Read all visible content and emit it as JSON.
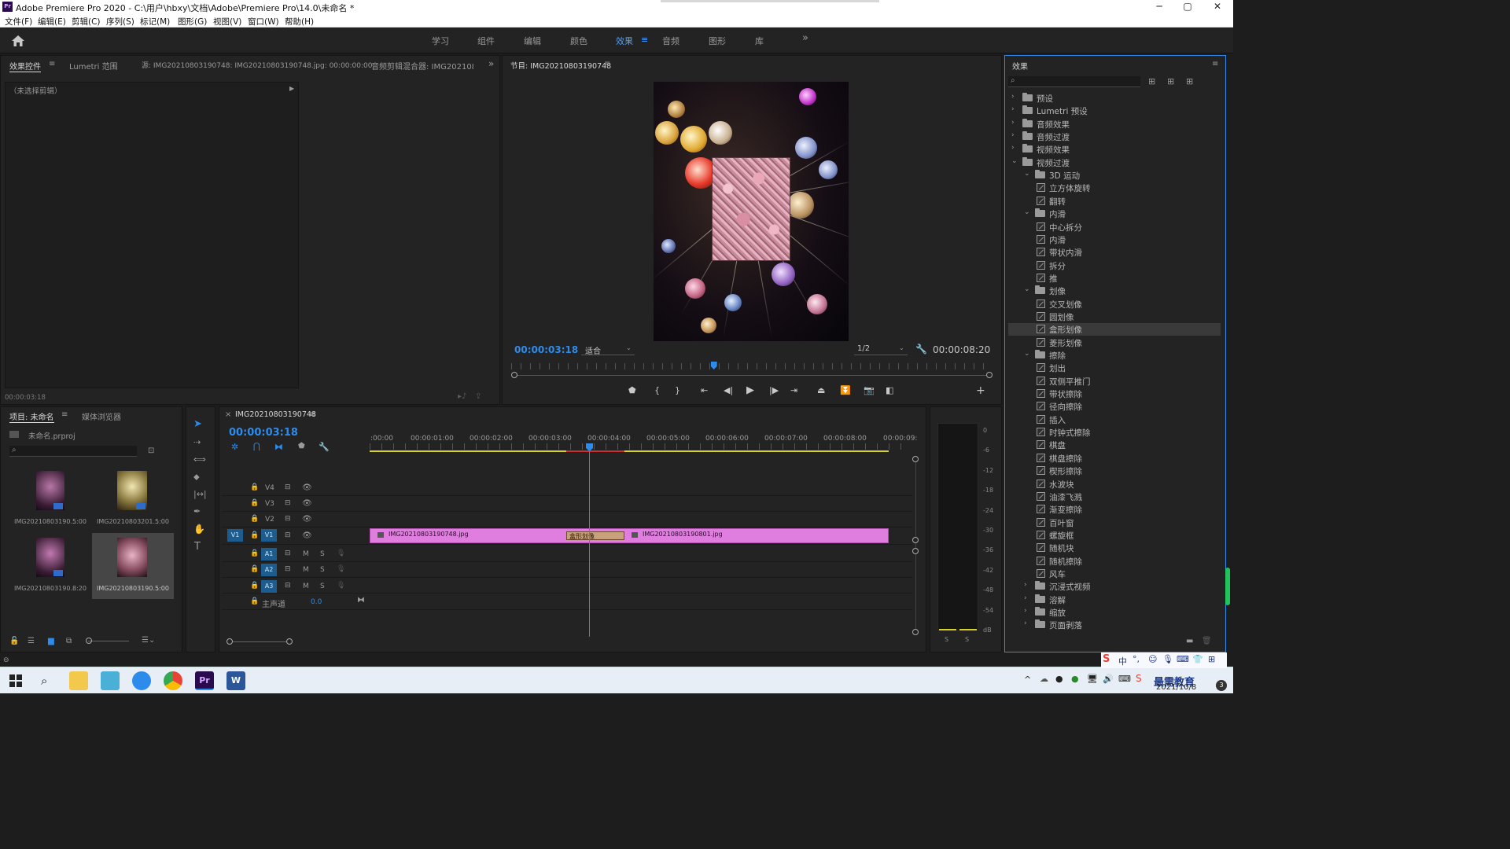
{
  "window": {
    "title": "Adobe Premiere Pro 2020 - C:\\用户\\hbxy\\文档\\Adobe\\Premiere Pro\\14.0\\未命名 *",
    "minimize": "─",
    "maximize": "▢",
    "close": "✕"
  },
  "menu": [
    "文件(F)",
    "编辑(E)",
    "剪辑(C)",
    "序列(S)",
    "标记(M)",
    "图形(G)",
    "视图(V)",
    "窗口(W)",
    "帮助(H)"
  ],
  "workspaces": {
    "items": [
      "学习",
      "组件",
      "编辑",
      "颜色",
      "效果",
      "音频",
      "图形",
      "库"
    ],
    "active": "效果",
    "more": "»"
  },
  "source_panel": {
    "tabs": [
      "效果控件",
      "Lumetri 范围",
      "源: IMG20210803190748: IMG20210803190748.jpg: 00:00:00:00",
      "音频剪辑混合器: IMG202108"
    ],
    "no_clip": "（未选择剪辑）",
    "timecode": "00:00:03:18"
  },
  "program_monitor": {
    "tab": "节目: IMG20210803190748",
    "current_timecode": "00:00:03:18",
    "fit": "适合",
    "resolution": "1/2",
    "duration": "00:00:08:20",
    "playhead_fraction": 0.42
  },
  "project_panel": {
    "tabs": [
      "项目: 未命名",
      "媒体浏览器"
    ],
    "project_file": "未命名.prproj",
    "items": [
      {
        "name": "IMG20210803190...",
        "duration": "5:00"
      },
      {
        "name": "IMG20210803201...",
        "duration": "5:00"
      },
      {
        "name": "IMG20210803190...",
        "duration": "8:20"
      },
      {
        "name": "IMG20210803190...",
        "duration": "5:00"
      }
    ]
  },
  "timeline": {
    "tab": "IMG20210803190748",
    "timecode": "00:00:03:18",
    "ruler": [
      ":00:00",
      "00:00:01:00",
      "00:00:02:00",
      "00:00:03:00",
      "00:00:04:00",
      "00:00:05:00",
      "00:00:06:00",
      "00:00:07:00",
      "00:00:08:00",
      "00:00:09:"
    ],
    "video_tracks": [
      "V4",
      "V3",
      "V2",
      "V1"
    ],
    "source_patch": "V1",
    "audio_tracks": [
      "A1",
      "A2",
      "A3"
    ],
    "mute": "M",
    "solo": "S",
    "master": "主声道",
    "master_level": "0.0",
    "clips": [
      {
        "name": "IMG20210803190748.jpg"
      },
      {
        "name": "IMG20210803190801.jpg"
      }
    ],
    "transition": "盒形划像"
  },
  "meter": {
    "scale": [
      "0",
      "-6",
      "-12",
      "-18",
      "-24",
      "-30",
      "-36",
      "-42",
      "-48",
      "-54",
      "dB"
    ],
    "solo_left": "S",
    "solo_right": "S"
  },
  "effects_panel": {
    "title": "效果",
    "tree": [
      {
        "label": "预设",
        "level": 0,
        "type": "folder",
        "open": false
      },
      {
        "label": "Lumetri 预设",
        "level": 0,
        "type": "folder",
        "open": false
      },
      {
        "label": "音频效果",
        "level": 0,
        "type": "folder",
        "open": false
      },
      {
        "label": "音频过渡",
        "level": 0,
        "type": "folder",
        "open": false
      },
      {
        "label": "视频效果",
        "level": 0,
        "type": "folder",
        "open": false
      },
      {
        "label": "视频过渡",
        "level": 0,
        "type": "folder",
        "open": true
      },
      {
        "label": "3D 运动",
        "level": 1,
        "type": "folder",
        "open": true
      },
      {
        "label": "立方体旋转",
        "level": 2,
        "type": "fx"
      },
      {
        "label": "翻转",
        "level": 2,
        "type": "fx"
      },
      {
        "label": "内滑",
        "level": 1,
        "type": "folder",
        "open": true
      },
      {
        "label": "中心拆分",
        "level": 2,
        "type": "fx"
      },
      {
        "label": "内滑",
        "level": 2,
        "type": "fx"
      },
      {
        "label": "带状内滑",
        "level": 2,
        "type": "fx"
      },
      {
        "label": "拆分",
        "level": 2,
        "type": "fx"
      },
      {
        "label": "推",
        "level": 2,
        "type": "fx"
      },
      {
        "label": "划像",
        "level": 1,
        "type": "folder",
        "open": true
      },
      {
        "label": "交叉划像",
        "level": 2,
        "type": "fx"
      },
      {
        "label": "圆划像",
        "level": 2,
        "type": "fx"
      },
      {
        "label": "盒形划像",
        "level": 2,
        "type": "fx",
        "selected": true
      },
      {
        "label": "菱形划像",
        "level": 2,
        "type": "fx"
      },
      {
        "label": "擦除",
        "level": 1,
        "type": "folder",
        "open": true
      },
      {
        "label": "划出",
        "level": 2,
        "type": "fx"
      },
      {
        "label": "双侧平推门",
        "level": 2,
        "type": "fx"
      },
      {
        "label": "带状擦除",
        "level": 2,
        "type": "fx"
      },
      {
        "label": "径向擦除",
        "level": 2,
        "type": "fx"
      },
      {
        "label": "插入",
        "level": 2,
        "type": "fx"
      },
      {
        "label": "时钟式擦除",
        "level": 2,
        "type": "fx"
      },
      {
        "label": "棋盘",
        "level": 2,
        "type": "fx"
      },
      {
        "label": "棋盘擦除",
        "level": 2,
        "type": "fx"
      },
      {
        "label": "楔形擦除",
        "level": 2,
        "type": "fx"
      },
      {
        "label": "水波块",
        "level": 2,
        "type": "fx"
      },
      {
        "label": "油漆飞溅",
        "level": 2,
        "type": "fx"
      },
      {
        "label": "渐变擦除",
        "level": 2,
        "type": "fx"
      },
      {
        "label": "百叶窗",
        "level": 2,
        "type": "fx"
      },
      {
        "label": "螺旋框",
        "level": 2,
        "type": "fx"
      },
      {
        "label": "随机块",
        "level": 2,
        "type": "fx"
      },
      {
        "label": "随机擦除",
        "level": 2,
        "type": "fx"
      },
      {
        "label": "风车",
        "level": 2,
        "type": "fx"
      },
      {
        "label": "沉浸式视频",
        "level": 1,
        "type": "folder",
        "open": false
      },
      {
        "label": "溶解",
        "level": 1,
        "type": "folder",
        "open": false
      },
      {
        "label": "缩放",
        "level": 1,
        "type": "folder",
        "open": false
      },
      {
        "label": "页面剥落",
        "level": 1,
        "type": "folder",
        "open": false
      }
    ]
  },
  "taskbar": {
    "ime": "中",
    "watermark": "最需教育",
    "date": "2021/10/8",
    "notification_count": "3"
  },
  "colors": {
    "accent": "#2d8ceb",
    "clip": "#e07ee0",
    "transition": "#c8a07a",
    "work_area": "#d8d02a"
  }
}
